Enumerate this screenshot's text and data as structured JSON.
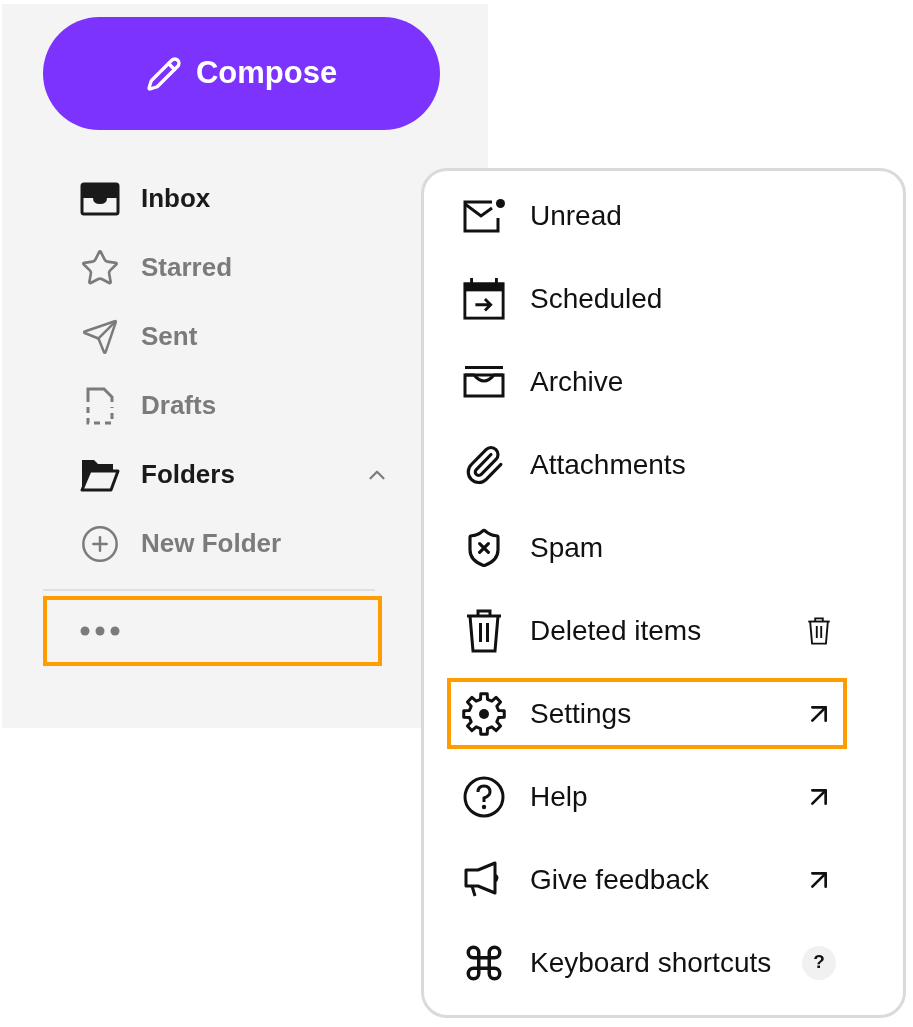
{
  "sidebar": {
    "compose_button": {
      "label": "Compose"
    },
    "items": [
      {
        "kind": "inbox",
        "label": "Inbox",
        "selected": true
      },
      {
        "kind": "starred",
        "label": "Starred",
        "selected": false
      },
      {
        "kind": "sent",
        "label": "Sent",
        "selected": false
      },
      {
        "kind": "drafts",
        "label": "Drafts",
        "selected": false
      }
    ],
    "folders": {
      "label": "Folders",
      "expanded": true,
      "items": [
        {
          "label": "New Folder"
        }
      ]
    },
    "more_button": {
      "highlighted": true
    }
  },
  "menu": {
    "items": [
      {
        "kind": "unread",
        "label": "Unread",
        "highlighted": false
      },
      {
        "kind": "scheduled",
        "label": "Scheduled",
        "highlighted": false
      },
      {
        "kind": "archive",
        "label": "Archive",
        "highlighted": false
      },
      {
        "kind": "attachments",
        "label": "Attachments",
        "highlighted": false
      },
      {
        "kind": "spam",
        "label": "Spam",
        "highlighted": false
      },
      {
        "kind": "deleted",
        "label": "Deleted items",
        "highlighted": false,
        "accessory": {
          "kind": "trash"
        }
      },
      {
        "kind": "settings",
        "label": "Settings",
        "highlighted": true,
        "accessory": {
          "kind": "external"
        }
      },
      {
        "kind": "help",
        "label": "Help",
        "highlighted": false,
        "accessory": {
          "kind": "external"
        }
      },
      {
        "kind": "feedback",
        "label": "Give feedback",
        "highlighted": false,
        "accessory": {
          "kind": "external"
        }
      },
      {
        "kind": "shortcuts",
        "label": "Keyboard shortcuts",
        "highlighted": false,
        "accessory": {
          "kind": "badge",
          "text": "?"
        }
      }
    ]
  }
}
